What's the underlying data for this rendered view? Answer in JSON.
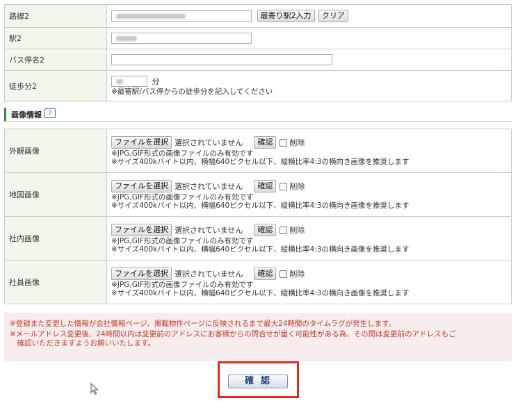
{
  "route_section": {
    "rows": [
      {
        "label": "路線2",
        "nearest_button": "最寄り駅2入力",
        "clear_button": "クリア"
      },
      {
        "label": "駅2"
      },
      {
        "label": "バス停名2"
      },
      {
        "label": "徒歩分2",
        "minutes_unit": "分",
        "note": "※最寄駅/バス停からの徒歩分を記入してください"
      }
    ]
  },
  "image_section": {
    "title": "画像情報",
    "help_icon": "?",
    "choose_file_label": "ファイルを選択",
    "no_file_text": "選択されていません",
    "confirm_label": "確認",
    "delete_label": "削除",
    "note1": "※JPG,GIF形式の画像ファイルのみ有効です",
    "note2": "※サイズ400kバイト以内、横幅640ピクセル以下、縦横比率4:3の横向き画像を推奨します",
    "rows": [
      {
        "label": "外観画像"
      },
      {
        "label": "地図画像"
      },
      {
        "label": "社内画像"
      },
      {
        "label": "社員画像"
      }
    ]
  },
  "warnings": [
    "※登録また変更した情報が会社情報ページ、掲載物件ページに反映されるまで最大24時間のタイムラグが発生します。",
    "※メールアドレス変更後、24時間以内は変更前のアドレスにお客様からの問合せが届く可能性がある為、その間は変更前のアドレスもご",
    "　確認いただきますようお願いいたします。"
  ],
  "submit": {
    "label": "確認"
  },
  "colors": {
    "accent_green": "#3b8a3b",
    "label_bg": "#f2f7ee",
    "warning_text": "#c0392b",
    "highlight_red": "#e02828"
  }
}
